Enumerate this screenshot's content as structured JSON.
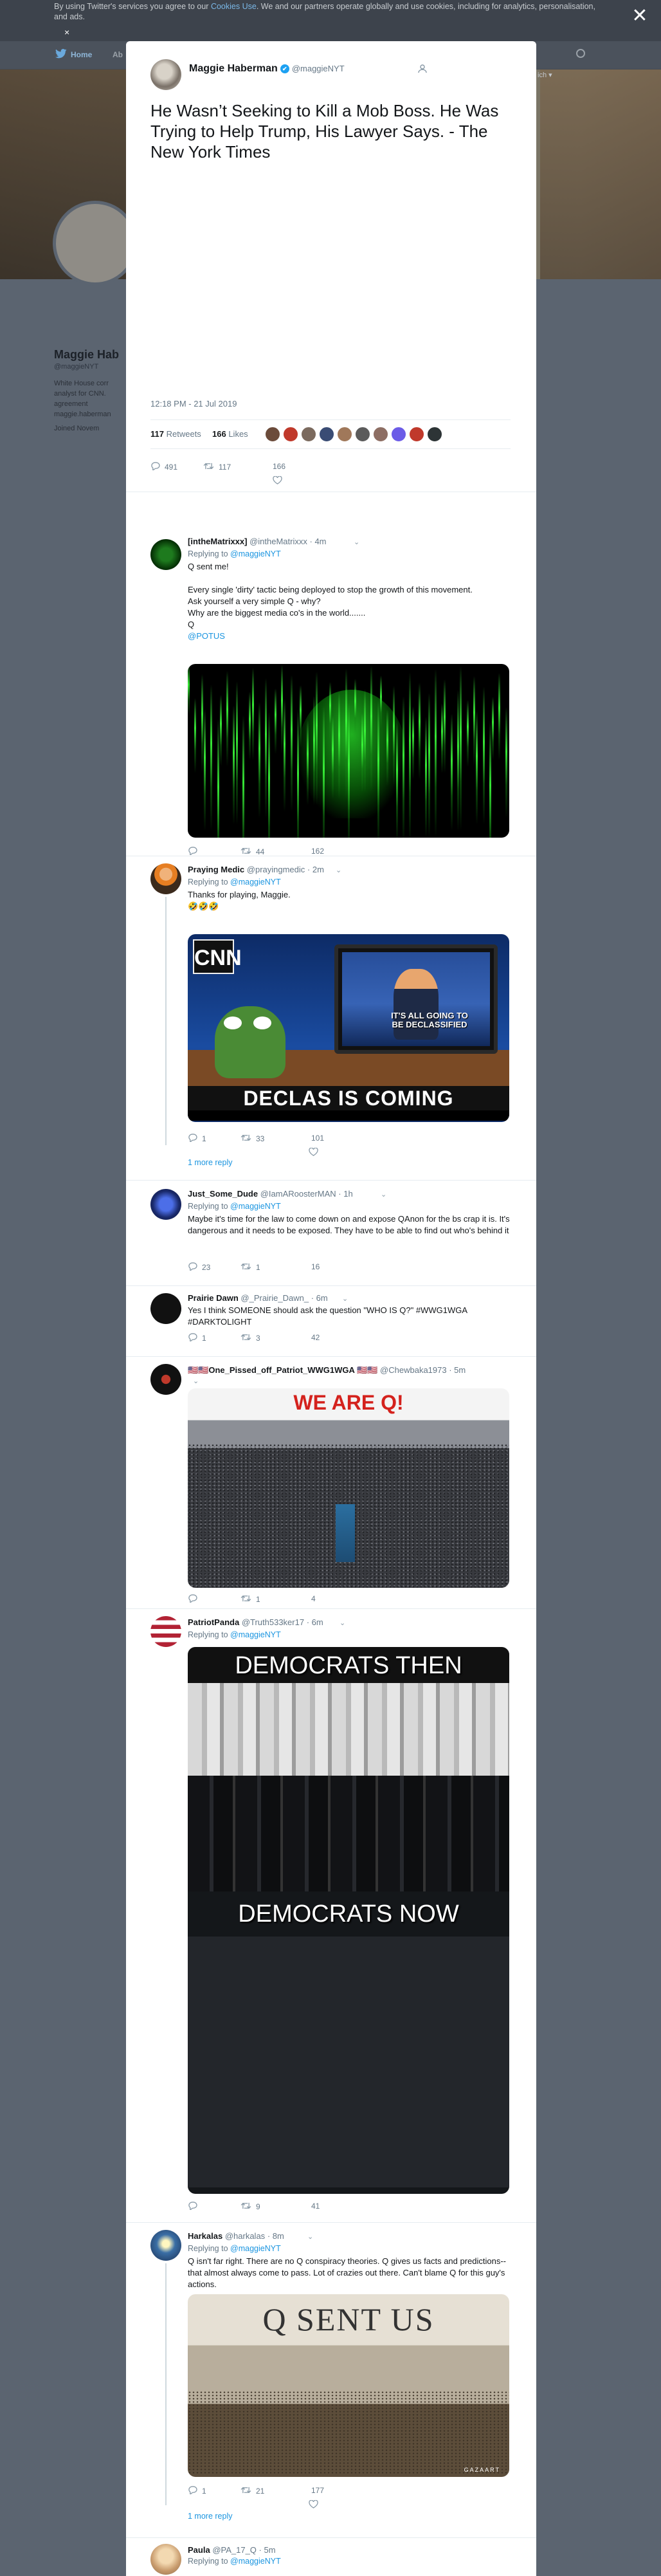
{
  "cookie_bar": {
    "text_before": "By using Twitter's services you agree to our ",
    "link": "Cookies Use",
    "text_after": ". We and our partners operate globally and use cookies, including for analytics, personalisation, and ads.",
    "close": "×"
  },
  "modal_close": "✕",
  "bg_nav": {
    "home": "Home",
    "about": "Ab",
    "lang": "ich ▾"
  },
  "bg_profile": {
    "name": "Maggie Hab",
    "handle": "@maggieNYT",
    "bio_line1": "White House corr",
    "bio_line2": "analyst for CNN.",
    "bio_line3": "agreement",
    "bio_line4": "maggie.haberman",
    "joined": "Joined Novem"
  },
  "main_tweet": {
    "name": "Maggie Haberman",
    "verified": "✔",
    "handle": "@maggieNYT",
    "text": "He Wasn’t Seeking to Kill a Mob Boss. He Was Trying to Help Trump, His Lawyer Says. - The New York Times",
    "time": "12:18 PM - 21 Jul 2019",
    "retweets_count": "117",
    "retweets_label": "Retweets",
    "likes_count": "166",
    "likes_label": "Likes",
    "actions": {
      "reply": "491",
      "retweet": "117",
      "like": "166"
    },
    "likers": [
      "#6b4b3a",
      "#c0392b",
      "#7b6a5e",
      "#3a4c74",
      "#a0785a",
      "#5b5b5b",
      "#8d6e63",
      "#6c5ce7",
      "#c0392b",
      "#2d3436"
    ]
  },
  "replies": [
    {
      "name": "[intheMatrixxx]",
      "handle": "@intheMatrixxx",
      "time": "· 4m",
      "replying_prefix": "Replying to ",
      "replying_to": "@maggieNYT",
      "text_lines": [
        "Q sent me!",
        "",
        "Every single 'dirty' tactic being deployed to stop the growth of this movement.",
        "Ask yourself a very simple Q - why?",
        "Why are the biggest media co's in the world.......",
        "Q",
        "@POTUS"
      ],
      "actions": {
        "reply": "",
        "retweet": "44",
        "like": "162"
      }
    },
    {
      "name": "Praying Medic",
      "handle": "@prayingmedic",
      "time": "· 2m",
      "replying_prefix": "Replying to ",
      "replying_to": "@maggieNYT",
      "text_lines": [
        "Thanks for playing, Maggie.",
        "🤣🤣🤣"
      ],
      "image_logo": "CNN",
      "image_caption": "IT'S ALL GOING TO BE DECLASSIFIED",
      "image_banner": "DECLAS IS COMING",
      "actions": {
        "reply": "1",
        "retweet": "33",
        "like": "101"
      },
      "more": "1 more reply"
    },
    {
      "name": "Just_Some_Dude",
      "handle": "@IamARoosterMAN",
      "time": "· 1h",
      "replying_prefix": "Replying to ",
      "replying_to": "@maggieNYT",
      "text_lines": [
        "Maybe it's time for the law to come down on and expose QAnon for the bs crap it is. It's dangerous and it needs to be exposed. They have to be able to find out who's behind it"
      ],
      "actions": {
        "reply": "23",
        "retweet": "1",
        "like": "16"
      }
    },
    {
      "name": "Prairie Dawn",
      "handle": "@_Prairie_Dawn_",
      "time": "· 6m",
      "replying_prefix": "",
      "replying_to": "",
      "text_lines": [
        "Yes I think SOMEONE should ask the question \"WHO IS Q?\" #WWG1WGA #DARKTOLIGHT"
      ],
      "actions": {
        "reply": "1",
        "retweet": "3",
        "like": "42"
      }
    },
    {
      "name": "🇺🇸🇺🇸One_Pissed_off_Patriot_WWG1WGA 🇺🇸🇺🇸",
      "handle": "@Chewbaka1973",
      "time": "· 5m",
      "replying_prefix": "",
      "replying_to": "",
      "text_lines": [],
      "image_title": "WE ARE Q!",
      "actions": {
        "reply": "",
        "retweet": "1",
        "like": "4"
      }
    },
    {
      "name": "PatriotPanda",
      "handle": "@Truth533ker17",
      "time": "· 6m",
      "replying_prefix": "Replying to ",
      "replying_to": "@maggieNYT",
      "text_lines": [],
      "image_top": "DEMOCRATS THEN",
      "image_bottom": "DEMOCRATS NOW",
      "actions": {
        "reply": "",
        "retweet": "9",
        "like": "41"
      }
    },
    {
      "name": "Harkalas",
      "handle": "@harkalas",
      "time": "· 8m",
      "replying_prefix": "Replying to ",
      "replying_to": "@maggieNYT",
      "text_lines": [
        "Q isn't far right. There are no Q conspiracy theories. Q gives us facts and predictions--that almost always come to pass. Lot of crazies out there. Can't blame Q for this guy's actions."
      ],
      "image_title": "Q SENT US",
      "image_sig": "GAZAART",
      "actions": {
        "reply": "1",
        "retweet": "21",
        "like": "177"
      },
      "more": "1 more reply"
    },
    {
      "name": "Paula",
      "handle": "@PA_17_Q",
      "time": "· 5m",
      "replying_prefix": "Replying to ",
      "replying_to": "@maggieNYT",
      "text_lines": [],
      "actions": {
        "reply": "",
        "retweet": "",
        "like": ""
      }
    }
  ]
}
